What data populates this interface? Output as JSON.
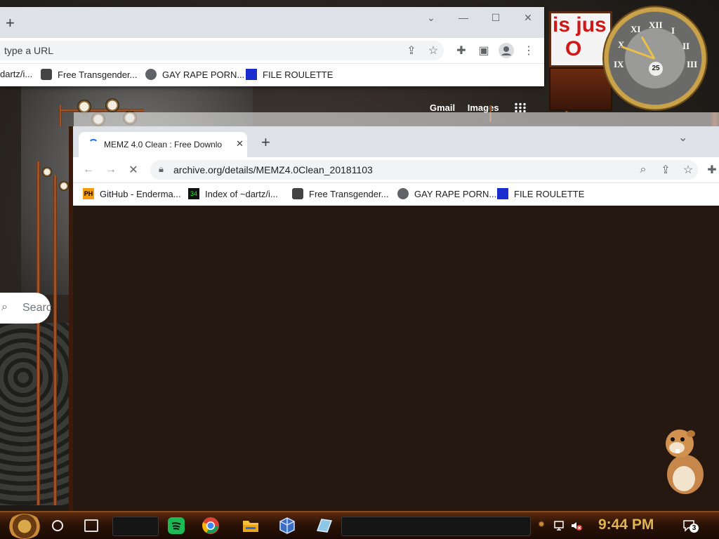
{
  "back_window": {
    "omnibox_placeholder": "type a URL",
    "bookmarks": [
      {
        "label": "dartz/i..."
      },
      {
        "label": "Free Transgender..."
      },
      {
        "label": "GAY RAPE PORN..."
      },
      {
        "label": "FILE ROULETTE"
      }
    ],
    "google_links": {
      "gmail": "Gmail",
      "images": "Images"
    },
    "search_placeholder": "Searc"
  },
  "front_window": {
    "tab_title": "MEMZ 4.0 Clean : Free Downlo",
    "url": "archive.org/details/MEMZ4.0Clean_20181103",
    "bookmarks": [
      {
        "label": "GitHub - Enderma...",
        "icon": "PH"
      },
      {
        "label": "Index of ~dartz/i...",
        "icon": "34"
      },
      {
        "label": "Free Transgender..."
      },
      {
        "label": "GAY RAPE PORN..."
      },
      {
        "label": "FILE ROULETTE"
      }
    ]
  },
  "promo": {
    "line1": "is jus",
    "line2": "O"
  },
  "clock_widget": {
    "date": "25",
    "numerals": [
      "XII",
      "I",
      "II",
      "III",
      "IX",
      "X",
      "XI"
    ]
  },
  "taskbar": {
    "time": "9:44 PM",
    "notification_count": "3",
    "apps": [
      "spotify-icon",
      "chrome-icon",
      "file-explorer-icon",
      "virtualbox-icon",
      "app-icon"
    ]
  },
  "colors": {
    "chrome_frame": "#dee1e6",
    "page_bg": "#241810",
    "clock_gold": "#e0b450",
    "promo_red": "#d01818"
  }
}
